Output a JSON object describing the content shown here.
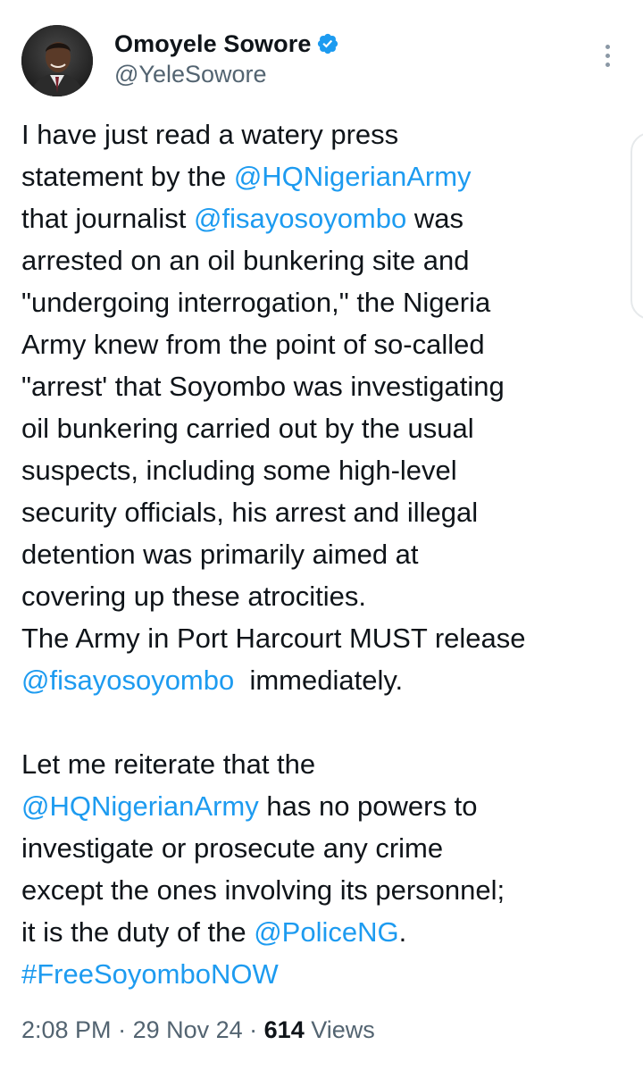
{
  "author": {
    "name": "Omoyele Sowore",
    "handle": "@YeleSowore",
    "verified": true
  },
  "tweet": {
    "lines": [
      [
        {
          "t": "I have just read a watery press"
        }
      ],
      [
        {
          "t": "statement by the "
        },
        {
          "t": "@HQNigerianArmy",
          "m": true
        }
      ],
      [
        {
          "t": "that journalist "
        },
        {
          "t": "@fisayosoyombo",
          "m": true
        },
        {
          "t": " was"
        }
      ],
      [
        {
          "t": "arrested on an oil bunkering site and"
        }
      ],
      [
        {
          "t": "\"undergoing interrogation,\" the Nigeria"
        }
      ],
      [
        {
          "t": "Army knew from the point of so-called"
        }
      ],
      [
        {
          "t": "\"arrest' that Soyombo was investigating"
        }
      ],
      [
        {
          "t": "oil bunkering carried out by the usual"
        }
      ],
      [
        {
          "t": "suspects, including some high-level"
        }
      ],
      [
        {
          "t": "security officials, his arrest and illegal"
        }
      ],
      [
        {
          "t": "detention was primarily aimed at"
        }
      ],
      [
        {
          "t": "covering up these atrocities."
        }
      ],
      [
        {
          "t": "The Army in Port Harcourt MUST release"
        }
      ],
      [
        {
          "t": "@fisayosoyombo",
          "m": true
        },
        {
          "t": "  immediately."
        }
      ],
      [],
      [
        {
          "t": "Let me reiterate that the"
        }
      ],
      [
        {
          "t": "@HQNigerianArmy",
          "m": true
        },
        {
          "t": " has no powers to"
        }
      ],
      [
        {
          "t": "investigate or prosecute any crime"
        }
      ],
      [
        {
          "t": "except the ones involving its personnel;"
        }
      ],
      [
        {
          "t": "it is the duty of the "
        },
        {
          "t": "@PoliceNG",
          "m": true
        },
        {
          "t": "."
        }
      ],
      [
        {
          "t": "#FreeSoyomboNOW",
          "h": true
        }
      ]
    ]
  },
  "meta": {
    "time": "2:08 PM",
    "separator": " · ",
    "date": "29 Nov 24",
    "views_count": "614",
    "views_label": " Views"
  },
  "icons": {
    "verified": "verified-badge-icon",
    "more": "more-options-icon"
  },
  "colors": {
    "link": "#1d9bf0",
    "text": "#0f1419",
    "secondary": "#536471"
  }
}
